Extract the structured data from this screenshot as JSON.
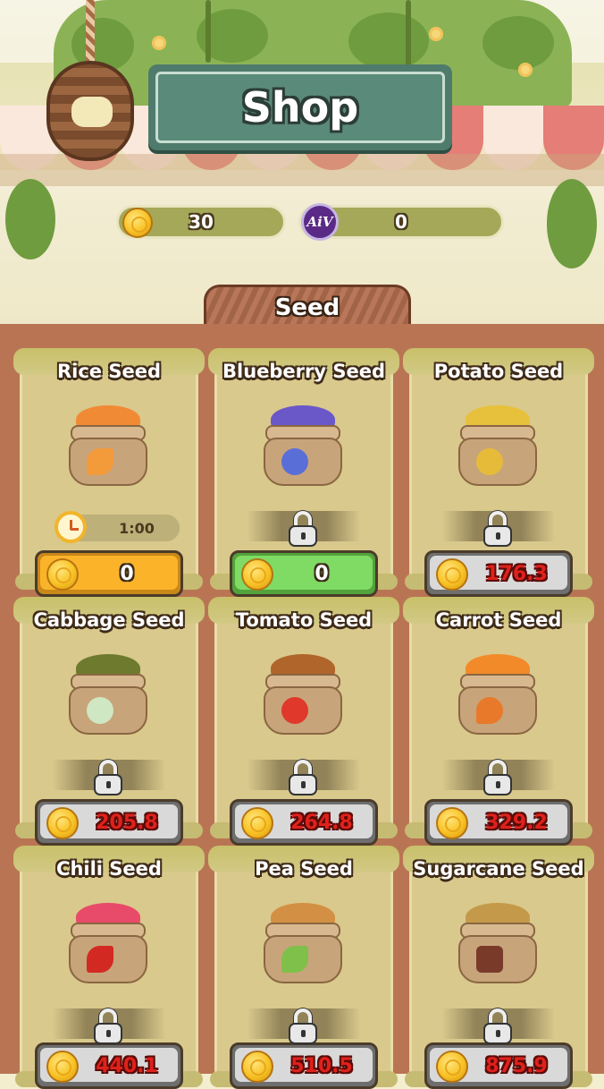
{
  "header": {
    "title": "Shop"
  },
  "currencies": [
    {
      "name": "coin",
      "value": "30",
      "icon": "coin-icon"
    },
    {
      "name": "token",
      "value": "0",
      "icon": "token-icon",
      "icon_text": "AiV"
    }
  ],
  "tab": {
    "label": "Seed"
  },
  "seeds": [
    {
      "name": "Rice Seed",
      "timer": "1:00",
      "price": "0",
      "state": "affordable",
      "button_color": "orange",
      "grain_color": "#f08a35",
      "badge_color": "#f39a3a"
    },
    {
      "name": "Blueberry Seed",
      "price": "0",
      "state": "locked",
      "button_color": "green",
      "grain_color": "#6a58c9",
      "badge_color": "#5a6ed8"
    },
    {
      "name": "Potato Seed",
      "price": "176.3",
      "state": "locked",
      "button_color": "gray",
      "grain_color": "#e7c13b",
      "badge_color": "#e6bb3a"
    },
    {
      "name": "Cabbage Seed",
      "price": "205.8",
      "state": "locked",
      "button_color": "gray",
      "grain_color": "#6e7a2e",
      "badge_color": "#cfe7c2"
    },
    {
      "name": "Tomato Seed",
      "price": "264.8",
      "state": "locked",
      "button_color": "gray",
      "grain_color": "#b0652a",
      "badge_color": "#e0382a"
    },
    {
      "name": "Carrot Seed",
      "price": "329.2",
      "state": "locked",
      "button_color": "gray",
      "grain_color": "#f28a2a",
      "badge_color": "#e8792a"
    },
    {
      "name": "Chili Seed",
      "price": "440.1",
      "state": "locked",
      "button_color": "gray",
      "grain_color": "#e84a6a",
      "badge_color": "#d22a22"
    },
    {
      "name": "Pea Seed",
      "price": "510.5",
      "state": "locked",
      "button_color": "gray",
      "grain_color": "#d39044",
      "badge_color": "#7fc04a"
    },
    {
      "name": "Sugarcane Seed",
      "price": "875.9",
      "state": "locked",
      "button_color": "gray",
      "grain_color": "#c49a4a",
      "badge_color": "#7a3a2a"
    }
  ]
}
